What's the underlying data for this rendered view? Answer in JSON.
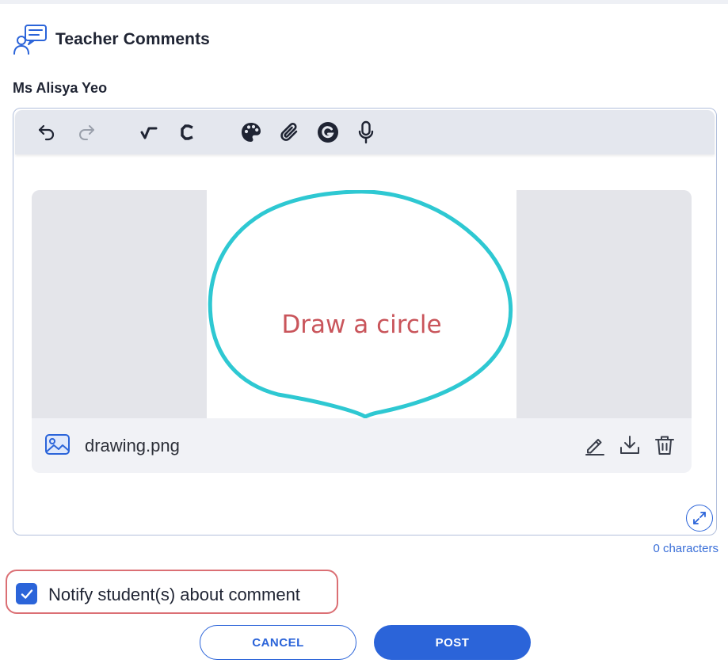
{
  "header": {
    "title": "Teacher Comments",
    "icon": "chat-bubbles-user-icon"
  },
  "author": {
    "name": "Ms Alisya Yeo"
  },
  "toolbar": {
    "buttons": [
      {
        "name": "undo",
        "icon": "undo-icon",
        "enabled": true
      },
      {
        "name": "redo",
        "icon": "redo-icon",
        "enabled": false
      },
      {
        "name": "math",
        "icon": "square-root-icon",
        "enabled": true
      },
      {
        "name": "chemistry",
        "icon": "chemistry-c-icon",
        "enabled": true
      },
      {
        "name": "drawing",
        "icon": "palette-icon",
        "enabled": true
      },
      {
        "name": "attach",
        "icon": "paperclip-icon",
        "enabled": true
      },
      {
        "name": "grammar",
        "icon": "grammarly-g-icon",
        "enabled": true
      },
      {
        "name": "audio",
        "icon": "microphone-icon",
        "enabled": true
      }
    ]
  },
  "attachment": {
    "preview_text": "Draw a circle",
    "file_name": "drawing.png",
    "file_icon": "image-icon",
    "actions": [
      "edit-icon",
      "download-icon",
      "delete-icon"
    ]
  },
  "editor": {
    "char_count": "0 characters",
    "expand_icon": "expand-icon"
  },
  "notify": {
    "checked": true,
    "label": "Notify student(s) about comment"
  },
  "actions": {
    "cancel_label": "CANCEL",
    "post_label": "POST"
  },
  "colors": {
    "primary": "#2b64d9",
    "drawing_stroke": "#2ec8d2",
    "drawing_text": "#c9555b",
    "highlight_border": "#db6f74"
  }
}
